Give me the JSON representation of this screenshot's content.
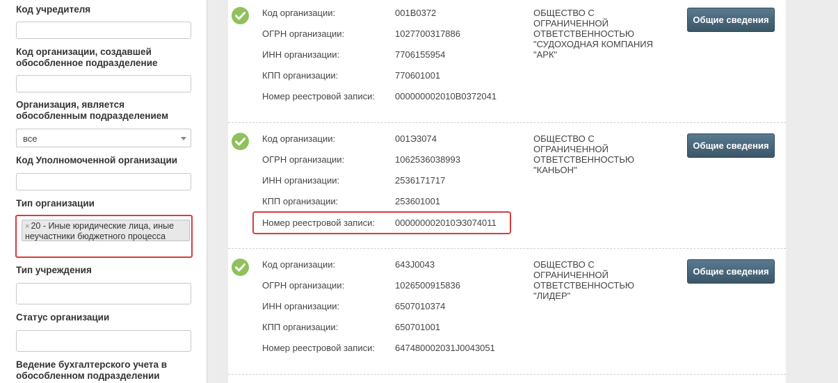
{
  "filters": {
    "founder_code": {
      "label": "Код учредителя",
      "value": ""
    },
    "creator_code": {
      "label": "Код организации, создавшей обособленное подразделение",
      "value": ""
    },
    "is_separate": {
      "label": "Организация, является обособленным подразделением",
      "value": "все"
    },
    "authorized_code": {
      "label": "Код Уполномоченной организации",
      "value": ""
    },
    "org_type": {
      "label": "Тип организации",
      "tag_remove": "×",
      "tag": "20 - Иные юридические лица, иные неучастники бюджетного процесса"
    },
    "institution_type": {
      "label": "Тип учреждения",
      "value": ""
    },
    "org_status": {
      "label": "Статус организации",
      "value": ""
    },
    "accounting": {
      "label": "Ведение бухгалтерского учета в обособленном подразделении"
    }
  },
  "field_labels": {
    "code": "Код организации:",
    "ogrn": "ОГРН организации:",
    "inn": "ИНН организации:",
    "kpp": "КПП организации:",
    "reg": "Номер реестровой записи:"
  },
  "button_label": "Общие сведения",
  "results": [
    {
      "code": "001B0372",
      "ogrn": "1027700317886",
      "inn": "7706155954",
      "kpp": "770601001",
      "reg": "000000002010B0372041",
      "name": [
        "ОБЩЕСТВО С",
        "ОГРАНИЧЕННОЙ",
        "ОТВЕТСТВЕННОСТЬЮ",
        "\"СУДОХОДНАЯ КОМПАНИЯ",
        "\"АРК\""
      ]
    },
    {
      "code": "001Э3074",
      "ogrn": "1062536038993",
      "inn": "2536171717",
      "kpp": "253601001",
      "reg": "000000002010Э3074011",
      "name": [
        "ОБЩЕСТВО С",
        "ОГРАНИЧЕННОЙ",
        "ОТВЕТСТВЕННОСТЬЮ",
        "\"КАНЬОН\""
      ]
    },
    {
      "code": "643J0043",
      "ogrn": "1026500915836",
      "inn": "6507010374",
      "kpp": "650701001",
      "reg": "647480002031J0043051",
      "name": [
        "ОБЩЕСТВО С",
        "ОГРАНИЧЕННОЙ",
        "ОТВЕТСТВЕННОСТЬЮ",
        "\"ЛИДЕР\""
      ]
    }
  ],
  "colors": {
    "check": "#8fc15c",
    "highlight": "#d63c3c",
    "button": "#4a6a80"
  }
}
